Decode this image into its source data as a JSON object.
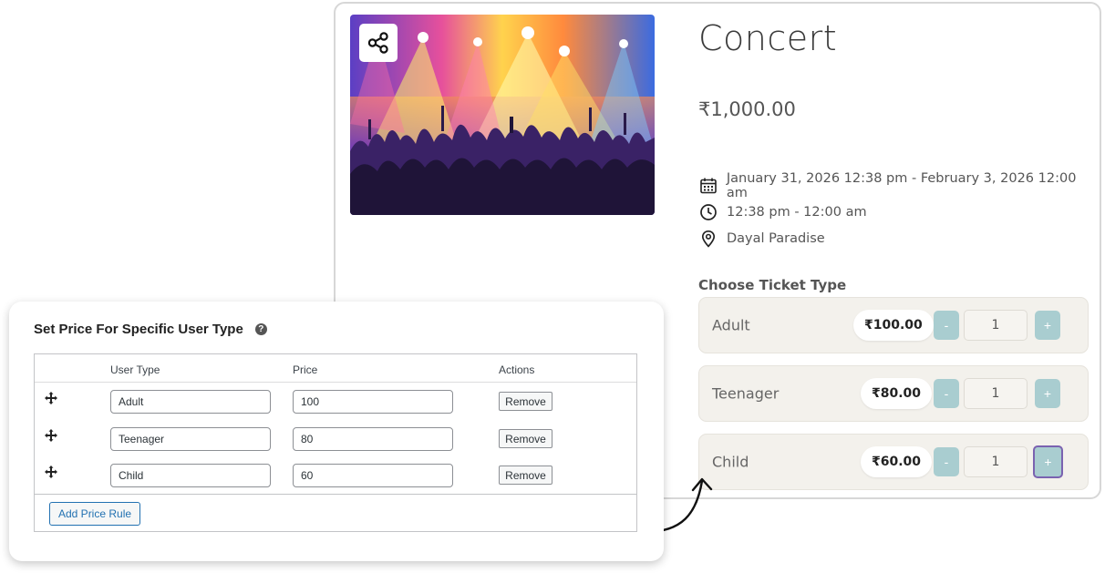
{
  "event": {
    "title": "Concert",
    "price": "₹1,000.00",
    "date_range": "January 31, 2026 12:38 pm - February 3, 2026 12:00 am",
    "time_range": "12:38 pm - 12:00 am",
    "location": "Dayal Paradise",
    "share_icon": "share-icon",
    "choose_ticket_label": "Choose Ticket Type",
    "tickets": [
      {
        "name": "Adult",
        "price": "₹100.00",
        "qty": "1",
        "minus": "-",
        "plus": "+"
      },
      {
        "name": "Teenager",
        "price": "₹80.00",
        "qty": "1",
        "minus": "-",
        "plus": "+"
      },
      {
        "name": "Child",
        "price": "₹60.00",
        "qty": "1",
        "minus": "-",
        "plus": "+"
      }
    ]
  },
  "admin": {
    "title": "Set Price For Specific User Type",
    "help_icon": "?",
    "columns": [
      "User Type",
      "Price",
      "Actions"
    ],
    "rows": [
      {
        "user_type": "Adult",
        "price": "100",
        "action": "Remove"
      },
      {
        "user_type": "Teenager",
        "price": "80",
        "action": "Remove"
      },
      {
        "user_type": "Child",
        "price": "60",
        "action": "Remove"
      }
    ],
    "add_button": "Add Price Rule"
  },
  "colors": {
    "qty_button": "#a9cdd0",
    "ticket_row_bg": "#f3f1ec",
    "focus_ring": "#7a62b0",
    "wp_blue": "#2271b1"
  }
}
